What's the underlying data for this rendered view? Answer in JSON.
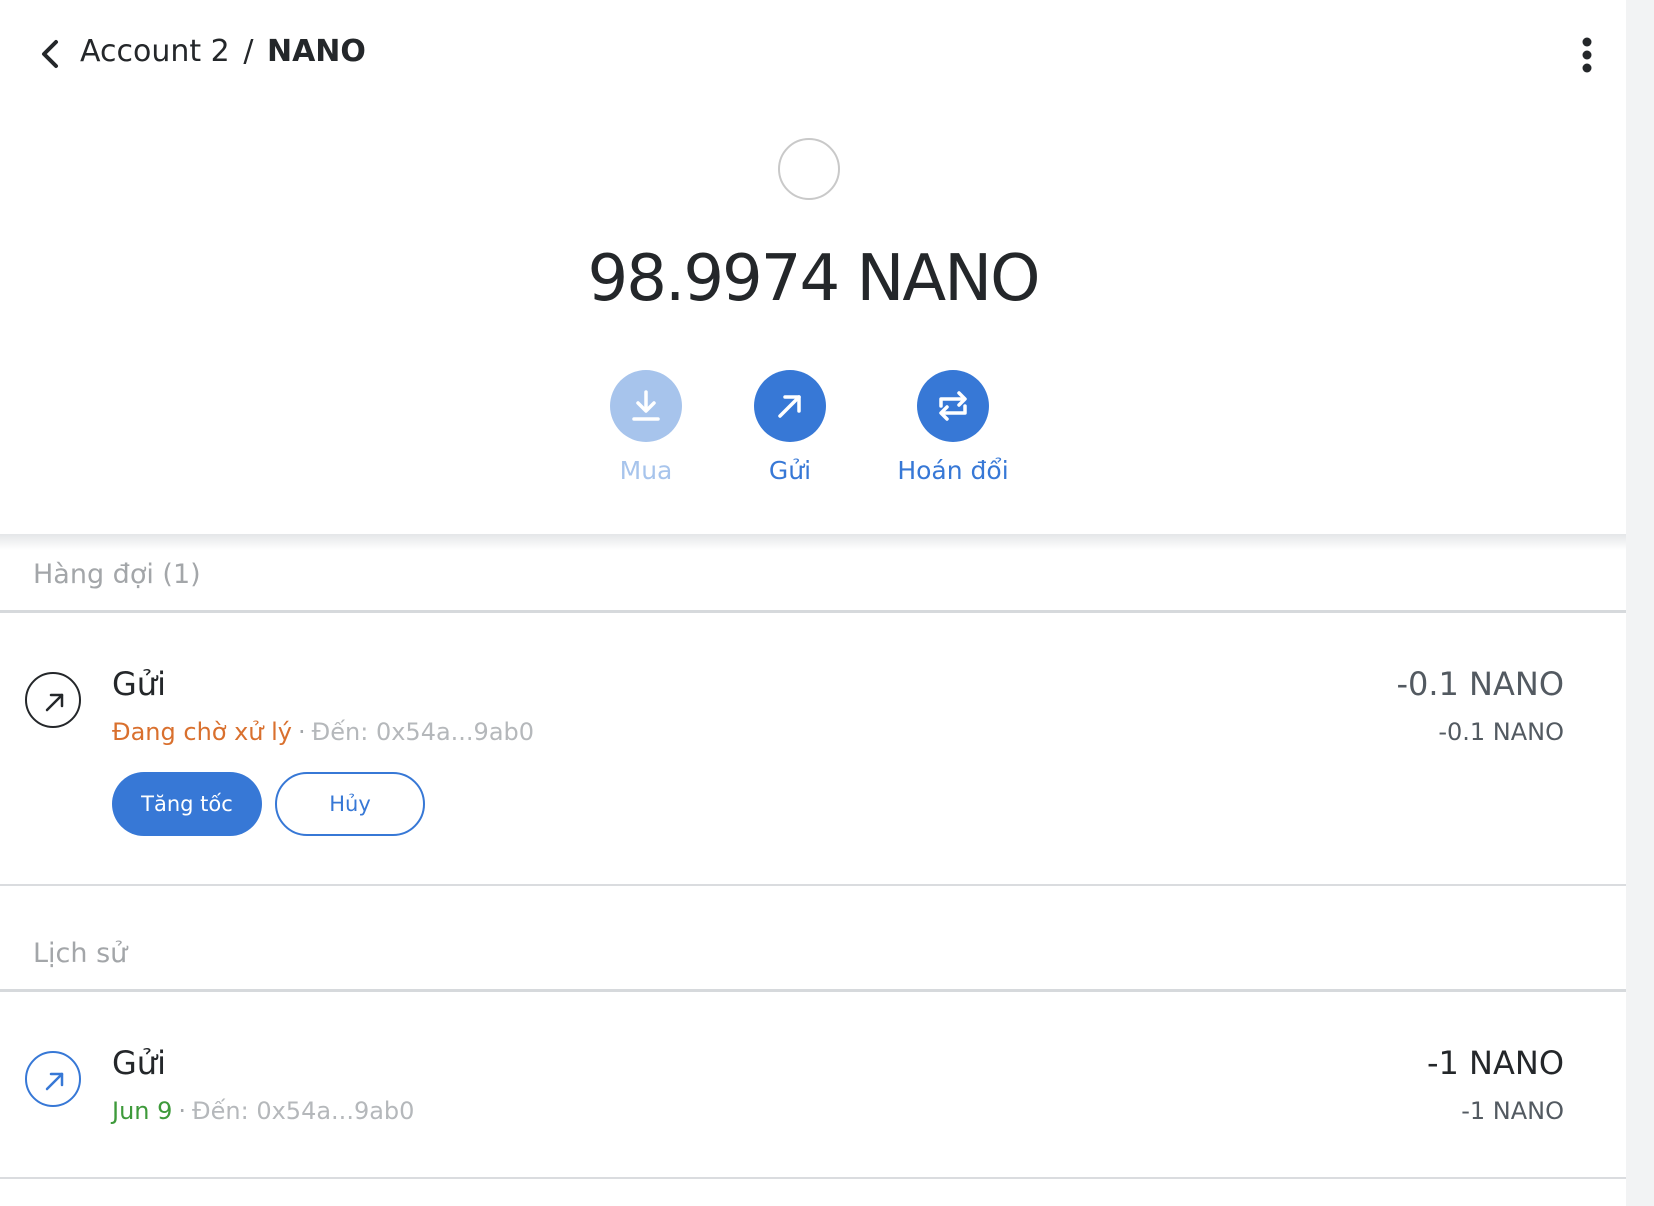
{
  "header": {
    "account": "Account 2",
    "separator": "/",
    "token": "NANO"
  },
  "balance": {
    "amount": "98.9974",
    "symbol": "NANO"
  },
  "actions": {
    "buy_label": "Mua",
    "send_label": "Gửi",
    "swap_label": "Hoán đổi"
  },
  "queue": {
    "title": "Hàng đợi (1)",
    "items": [
      {
        "title": "Gửi",
        "status": "Đang chờ xử lý",
        "status_color": "#d9702e",
        "to": "Đến: 0x54a...9ab0",
        "amount": "-0.1 NANO",
        "amount_sub": "-0.1 NANO",
        "speed_up_label": "Tăng tốc",
        "cancel_label": "Hủy"
      }
    ]
  },
  "history": {
    "title": "Lịch sử",
    "items": [
      {
        "title": "Gửi",
        "date": "Jun 9",
        "date_color": "#3e9a3b",
        "to": "Đến: 0x54a...9ab0",
        "amount": "-1 NANO",
        "amount_sub": "-1 NANO"
      }
    ]
  },
  "colors": {
    "accent": "#3778d6",
    "accent_disabled": "#a7c4ec",
    "pending": "#d9702e",
    "confirmed": "#3e9a3b"
  }
}
